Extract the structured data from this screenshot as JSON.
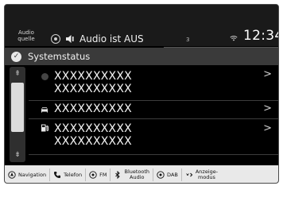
{
  "topbar": {
    "source_label": [
      "Audio",
      "quelle"
    ],
    "audio_status": "Audio ist AUS",
    "signal_number": "3",
    "time": "12:34"
  },
  "header": {
    "title": "Systemstatus"
  },
  "list": {
    "rows": [
      {
        "lines": [
          "XXXXXXXXXX",
          "XXXXXXXXXX"
        ],
        "icon": "dot-icon"
      },
      {
        "lines": [
          "XXXXXXXXXX"
        ],
        "icon": "car-icon"
      },
      {
        "lines": [
          "XXXXXXXXXX",
          "XXXXXXXXXX"
        ],
        "icon": "fuel-icon"
      }
    ]
  },
  "bottombar": {
    "items": [
      {
        "label": "Navigation",
        "icon": "navigation-icon"
      },
      {
        "label": "Telefon",
        "icon": "phone-icon"
      },
      {
        "label": "FM",
        "icon": "radio-icon"
      },
      {
        "label": [
          "Bluetooth",
          "Audio"
        ],
        "icon": "bluetooth-icon"
      },
      {
        "label": "DAB",
        "icon": "radio-icon"
      },
      {
        "label": [
          "Anzeige-",
          "modus"
        ],
        "icon": "display-mode-icon"
      }
    ]
  }
}
